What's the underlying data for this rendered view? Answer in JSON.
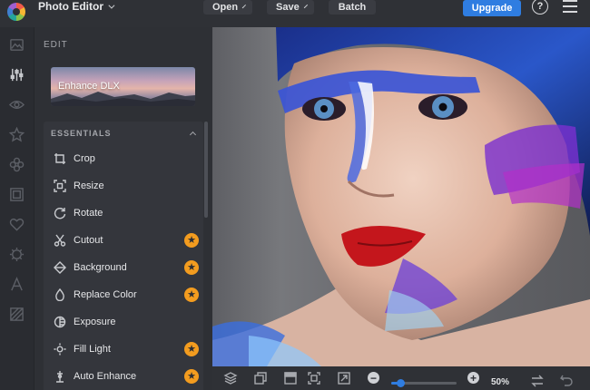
{
  "topbar": {
    "app_title": "Photo Editor",
    "menus": [
      {
        "label": "Open"
      },
      {
        "label": "Save"
      },
      {
        "label": "Batch"
      }
    ],
    "upgrade_label": "Upgrade",
    "help_label": "?",
    "brand_accent": "#2f7de1"
  },
  "rail": {
    "items": [
      {
        "icon": "image-icon"
      },
      {
        "icon": "sliders-icon",
        "active": true
      },
      {
        "icon": "eye-icon"
      },
      {
        "icon": "star-icon"
      },
      {
        "icon": "flower-icon"
      },
      {
        "icon": "frame-icon"
      },
      {
        "icon": "heart-icon"
      },
      {
        "icon": "texture-icon"
      },
      {
        "icon": "text-icon"
      },
      {
        "icon": "overlay-icon"
      }
    ]
  },
  "panel": {
    "section_label": "EDIT",
    "enhance_card_label": "Enhance DLX",
    "essentials_header": "ESSENTIALS",
    "tools": [
      {
        "label": "Crop",
        "icon": "crop-icon",
        "premium": false
      },
      {
        "label": "Resize",
        "icon": "resize-icon",
        "premium": false
      },
      {
        "label": "Rotate",
        "icon": "rotate-icon",
        "premium": false
      },
      {
        "label": "Cutout",
        "icon": "scissors-icon",
        "premium": true
      },
      {
        "label": "Background",
        "icon": "background-icon",
        "premium": true
      },
      {
        "label": "Replace Color",
        "icon": "droplet-icon",
        "premium": true
      },
      {
        "label": "Exposure",
        "icon": "exposure-icon",
        "premium": false
      },
      {
        "label": "Fill Light",
        "icon": "sun-icon",
        "premium": true
      },
      {
        "label": "Auto Enhance",
        "icon": "wand-icon",
        "premium": true
      }
    ],
    "premium_color": "#f39c1f"
  },
  "bottombar": {
    "tools": [
      {
        "icon": "layers-icon"
      },
      {
        "icon": "compare-icon"
      },
      {
        "icon": "split-view-icon"
      },
      {
        "icon": "fit-screen-icon"
      },
      {
        "icon": "export-icon"
      }
    ],
    "zoom_value": "50%",
    "zoom_level": 0.14,
    "minus_label": "−",
    "plus_label": "+"
  }
}
